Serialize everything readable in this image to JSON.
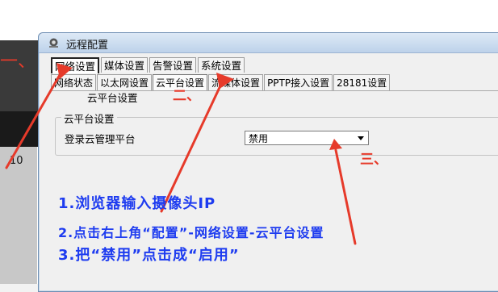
{
  "background": {
    "number_label": "10",
    "mark_one": "一、"
  },
  "window": {
    "title": "远程配置"
  },
  "main_tabs": [
    {
      "label": "网络设置",
      "active": true
    },
    {
      "label": "媒体设置",
      "active": false
    },
    {
      "label": "告警设置",
      "active": false
    },
    {
      "label": "系统设置",
      "active": false
    }
  ],
  "sub_tabs": [
    {
      "label": "网络状态",
      "active": false
    },
    {
      "label": "以太网设置",
      "active": false
    },
    {
      "label": "云平台设置",
      "active": true
    },
    {
      "label": "流媒体设置",
      "active": false
    },
    {
      "label": "PPTP接入设置",
      "active": false
    },
    {
      "label": "28181设置",
      "active": false
    }
  ],
  "panel": {
    "subtitle": "云平台设置",
    "group_title": "云平台设置",
    "field_label": "登录云管理平台",
    "select_value": "禁用"
  },
  "annotations": {
    "mark_two": "二、",
    "mark_three": "三、",
    "step1": "1.浏览器输入摄像头IP",
    "step2": "2.点击右上角“配置”-网络设置-云平台设置",
    "step3": "3.把“禁用”点击成“启用”",
    "arrow_color": "#e63a2a",
    "text_color": "#1e3cf0"
  }
}
